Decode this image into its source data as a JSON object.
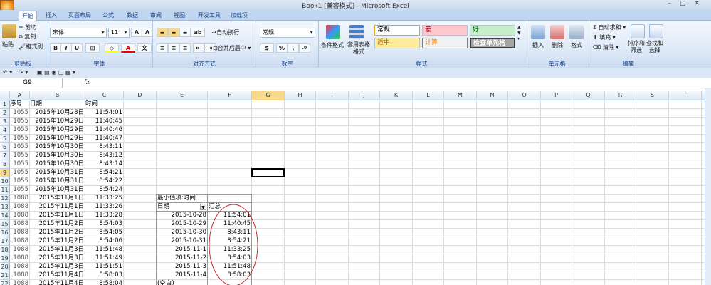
{
  "window": {
    "title": "Book1  [兼容模式] - Microsoft Excel"
  },
  "tabs": [
    "开始",
    "插入",
    "页面布局",
    "公式",
    "数据",
    "审阅",
    "视图",
    "开发工具",
    "加载项"
  ],
  "ribbon": {
    "clipboard": {
      "label": "剪贴板",
      "paste": "粘贴",
      "cut": "剪切",
      "copy": "复制",
      "format_painter": "格式刷"
    },
    "font": {
      "label": "字体",
      "name": "宋体",
      "size": "11",
      "bold": "B",
      "italic": "I",
      "underline": "U"
    },
    "alignment": {
      "label": "对齐方式",
      "wrap": "自动换行",
      "merge": "合并后居中"
    },
    "number": {
      "label": "数字",
      "format": "常规",
      "percent": "%"
    },
    "styles": {
      "label": "样式",
      "conditional": "条件格式",
      "table": "套用表格格式",
      "cells": [
        "常规",
        "差",
        "好",
        "适中",
        "计算",
        "检查单元格"
      ],
      "colors": {
        "normal": "#ffffff",
        "bad": "#ffc7ce",
        "good": "#c6efce",
        "neutral": "#ffeb9c",
        "calc": "#f2f2f2",
        "check": "#a5a5a5"
      }
    },
    "cells": {
      "label": "单元格",
      "insert": "插入",
      "delete": "删除",
      "format": "格式"
    },
    "editing": {
      "label": "编辑",
      "autosum": "自动求和",
      "fill": "填充",
      "clear": "清除",
      "sort": "排序和筛选",
      "find": "查找和选择"
    }
  },
  "formula_bar": {
    "name_box": "G9",
    "fx": "fx",
    "content": ""
  },
  "columns": [
    "A",
    "B",
    "C",
    "D",
    "E",
    "F",
    "G",
    "H",
    "I",
    "J",
    "K",
    "L",
    "M",
    "N",
    "O",
    "P",
    "Q",
    "R",
    "S",
    "T"
  ],
  "selected_column": "G",
  "selected_row": "9",
  "rows": [
    "1",
    "2",
    "3",
    "4",
    "5",
    "6",
    "7",
    "8",
    "9",
    "10",
    "11",
    "12",
    "13",
    "14",
    "15",
    "16",
    "17",
    "18",
    "19",
    "20",
    "21",
    "22"
  ],
  "sheet": {
    "headers": [
      "序号",
      "日期",
      "时间"
    ],
    "data": [
      [
        "1055",
        "2015年10月28日",
        "11:54:01"
      ],
      [
        "1055",
        "2015年10月29日",
        "11:40:45"
      ],
      [
        "1055",
        "2015年10月29日",
        "11:40:46"
      ],
      [
        "1055",
        "2015年10月29日",
        "11:40:47"
      ],
      [
        "1055",
        "2015年10月30日",
        "8:43:11"
      ],
      [
        "1055",
        "2015年10月30日",
        "8:43:12"
      ],
      [
        "1055",
        "2015年10月30日",
        "8:43:14"
      ],
      [
        "1055",
        "2015年10月31日",
        "8:54:21"
      ],
      [
        "1055",
        "2015年10月31日",
        "8:54:22"
      ],
      [
        "1055",
        "2015年10月31日",
        "8:54:24"
      ],
      [
        "1088",
        "2015年11月1日",
        "11:33:25"
      ],
      [
        "1088",
        "2015年11月1日",
        "11:33:26"
      ],
      [
        "1088",
        "2015年11月1日",
        "11:33:28"
      ],
      [
        "1088",
        "2015年11月2日",
        "8:54:03"
      ],
      [
        "1088",
        "2015年11月2日",
        "8:54:05"
      ],
      [
        "1088",
        "2015年11月2日",
        "8:54:06"
      ],
      [
        "1088",
        "2015年11月3日",
        "11:51:48"
      ],
      [
        "1088",
        "2015年11月3日",
        "11:51:49"
      ],
      [
        "1088",
        "2015年11月3日",
        "11:51:51"
      ],
      [
        "1088",
        "2015年11月4日",
        "8:58:03"
      ],
      [
        "1088",
        "2015年11月4日",
        "8:58:04"
      ]
    ]
  },
  "pivot": {
    "title": "最小值项:时间",
    "row_header": "日期",
    "col_header": "汇总",
    "rows": [
      [
        "2015-10-28",
        "11:54:01"
      ],
      [
        "2015-10-29",
        "11:40:45"
      ],
      [
        "2015-10-30",
        "8:43:11"
      ],
      [
        "2015-10-31",
        "8:54:21"
      ],
      [
        "2015-11-1",
        "11:33:25"
      ],
      [
        "2015-11-2",
        "8:54:03"
      ],
      [
        "2015-11-3",
        "11:51:48"
      ],
      [
        "2015-11-4",
        "8:58:03"
      ]
    ],
    "blank": "(空白)"
  }
}
